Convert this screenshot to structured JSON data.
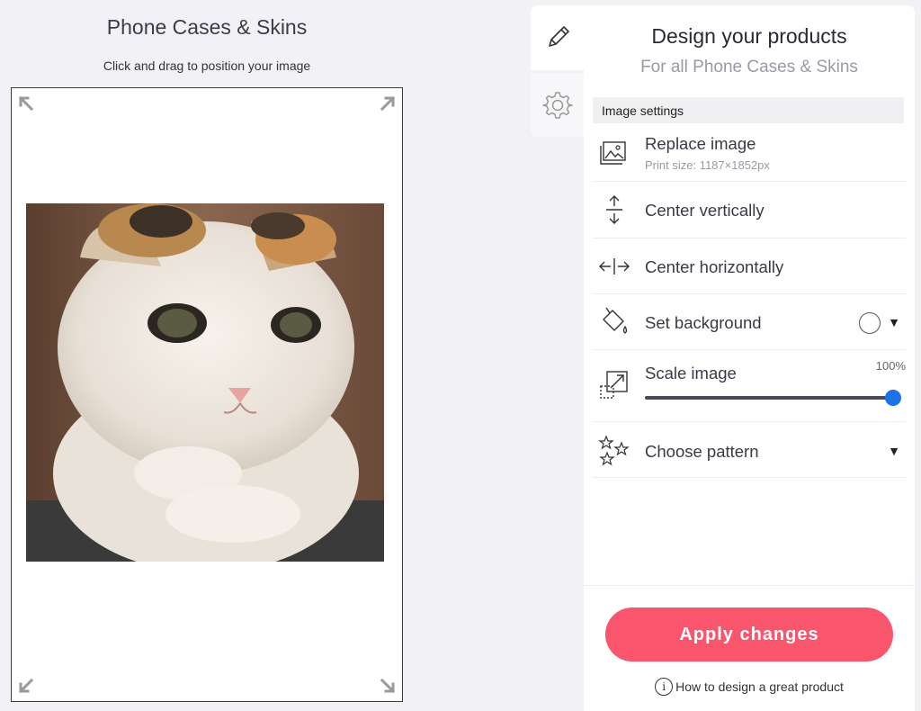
{
  "editor": {
    "title": "Phone Cases & Skins",
    "hint": "Click and drag to position your image"
  },
  "tabs": [
    {
      "name": "design",
      "icon": "pencil-icon",
      "active": true
    },
    {
      "name": "settings",
      "icon": "gear-icon",
      "active": false
    }
  ],
  "panel": {
    "title": "Design your products",
    "subtitle": "For all Phone Cases & Skins",
    "section_label": "Image settings",
    "items": {
      "replace": {
        "label": "Replace image",
        "sub": "Print size: 1187×1852px",
        "icon": "image-gallery-icon"
      },
      "center_v": {
        "label": "Center vertically",
        "icon": "vertical-arrows-icon"
      },
      "center_h": {
        "label": "Center horizontally",
        "icon": "horizontal-arrows-icon"
      },
      "background": {
        "label": "Set background",
        "icon": "paint-bucket-icon",
        "swatch": "#ffffff"
      },
      "scale": {
        "label": "Scale image",
        "value_text": "100%",
        "value": 1.0,
        "icon": "scale-icon"
      },
      "pattern": {
        "label": "Choose pattern",
        "icon": "stars-icon"
      }
    },
    "apply_label": "Apply changes",
    "help_label": "How to design a great product"
  },
  "colors": {
    "accent": "#f9566e",
    "slider": "#1a73e8"
  }
}
